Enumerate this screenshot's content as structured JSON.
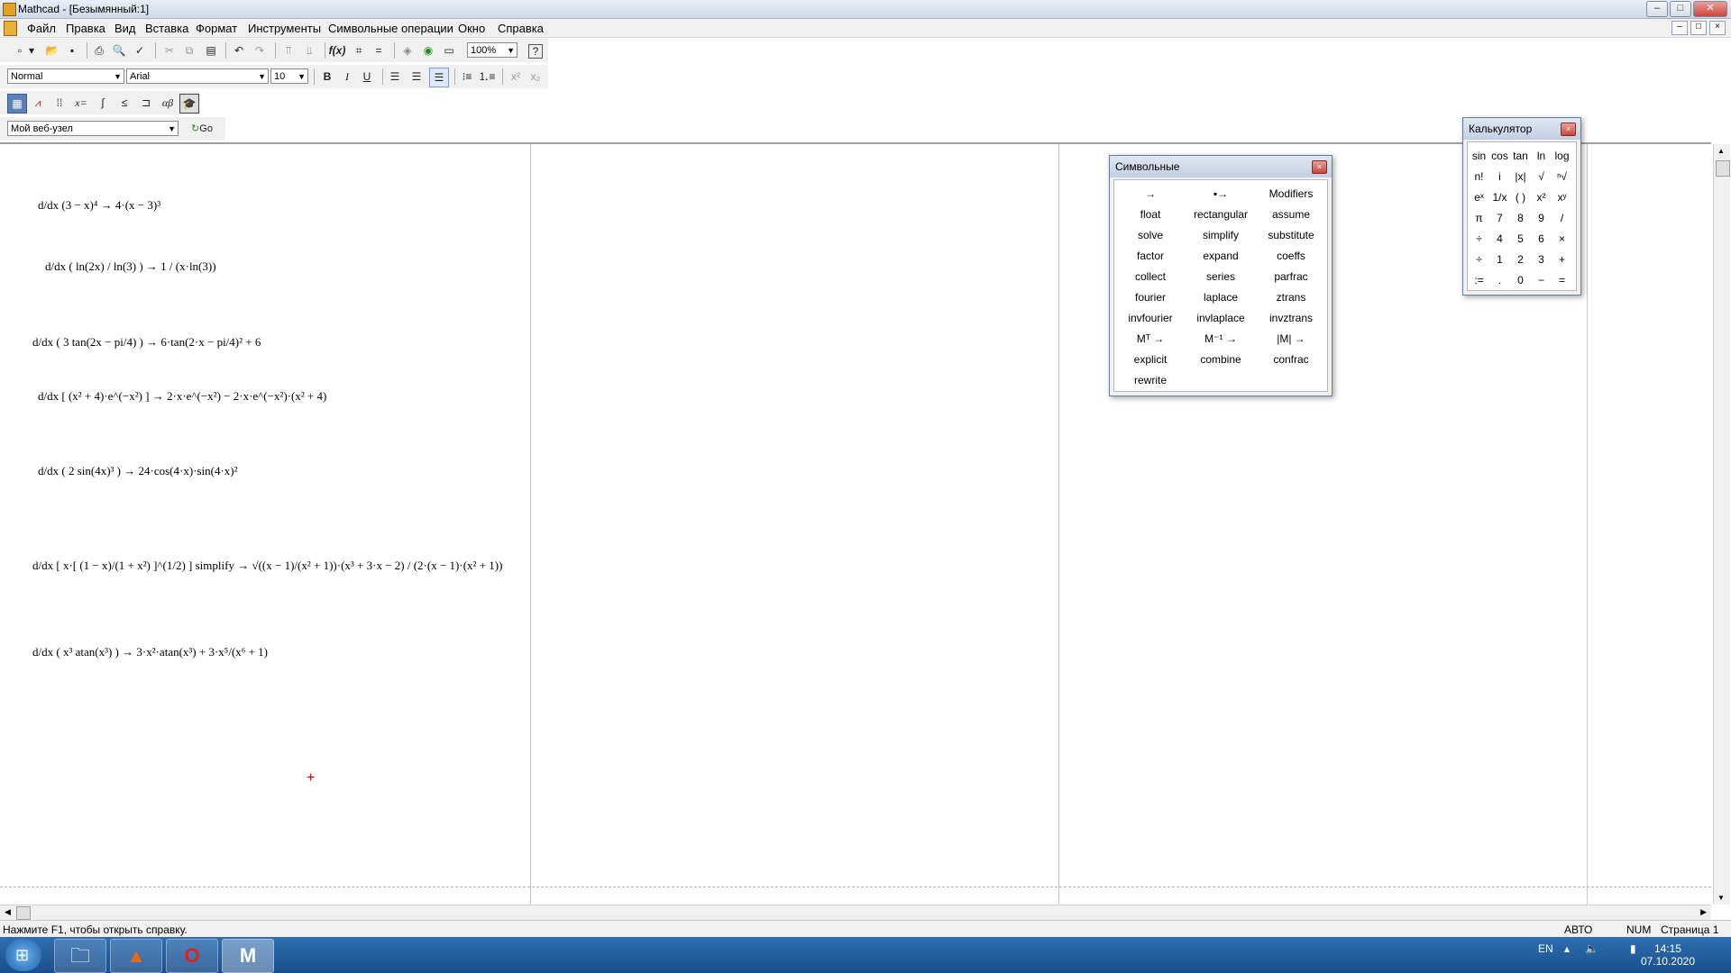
{
  "window": {
    "title": "Mathcad - [Безымянный:1]",
    "controls": [
      "–",
      "□",
      "✕"
    ]
  },
  "menu": {
    "items": [
      "Файл",
      "Правка",
      "Вид",
      "Вставка",
      "Формат",
      "Инструменты",
      "Символьные операции",
      "Окно",
      "Справка"
    ],
    "mdi_controls": [
      "–",
      "□",
      "×"
    ]
  },
  "toolbar_standard": {
    "zoom": "100%",
    "icons": [
      "new-icon",
      "open-icon",
      "save-icon",
      "print-icon",
      "print-preview-icon",
      "spell-check-icon",
      "cut-icon",
      "copy-icon",
      "paste-icon",
      "undo-icon",
      "redo-icon",
      "align-icon",
      "align-bottom-icon",
      "insert-function-icon",
      "insert-unit-icon",
      "calculate-icon",
      "component-icon",
      "resource-icon",
      "window-icon",
      "help-icon"
    ]
  },
  "toolbar_format": {
    "style": "Normal",
    "font": "Arial",
    "size": "10",
    "bold": "B",
    "italic": "I",
    "underline": "U"
  },
  "toolbar_math": {
    "icons": [
      "calculator-toolbar-icon",
      "graph-toolbar-icon",
      "matrix-toolbar-icon",
      "evaluation-toolbar-icon",
      "calculus-toolbar-icon",
      "boolean-toolbar-icon",
      "programming-toolbar-icon",
      "greek-toolbar-icon",
      "symbolic-toolbar-icon"
    ],
    "evaluation_label": "x=",
    "greek_label": "αβ"
  },
  "toolbar_web": {
    "url": "Мой веб-узел",
    "go_label": "Go"
  },
  "worksheet": {
    "expressions": [
      "d/dx (3 − x)⁴ → 4·(x − 3)³",
      "d/dx ( ln(2x) / ln(3) ) → 1 / (x·ln(3))",
      "d/dx ( 3 tan(2x − pi/4) ) → 6·tan(2·x − pi/4)² + 6",
      "d/dx [ (x² + 4)·e^(−x²) ] → 2·x·e^(−x²) − 2·x·e^(−x²)·(x² + 4)",
      "d/dx ( 2 sin(4x)³ ) → 24·cos(4·x)·sin(4·x)²",
      "d/dx [ x·[ (1 − x)/(1 + x²) ]^(1/2) ] simplify → √((x − 1)/(x² + 1))·(x³ + 3·x − 2) / (2·(x − 1)·(x² + 1))",
      "d/dx ( x³ atan(x³) ) → 3·x²·atan(x³) + 3·x⁵/(x⁶ + 1)"
    ],
    "cursor": "+"
  },
  "symbolic_palette": {
    "title": "Символьные",
    "close": "×",
    "rows": [
      [
        "→",
        "▪→",
        "Modifiers"
      ],
      [
        "float",
        "rectangular",
        "assume"
      ],
      [
        "solve",
        "simplify",
        "substitute"
      ],
      [
        "factor",
        "expand",
        "coeffs"
      ],
      [
        "collect",
        "series",
        "parfrac"
      ],
      [
        "fourier",
        "laplace",
        "ztrans"
      ],
      [
        "invfourier",
        "invlaplace",
        "invztrans"
      ],
      [
        "Mᵀ →",
        "M⁻¹ →",
        "|M| →"
      ],
      [
        "explicit",
        "combine",
        "confrac"
      ],
      [
        "rewrite",
        "",
        ""
      ]
    ]
  },
  "calculator_palette": {
    "title": "Калькулятор",
    "close": "×",
    "rows": [
      [
        "sin",
        "cos",
        "tan",
        "ln",
        "log"
      ],
      [
        "n!",
        "i",
        "|x|",
        "√",
        "ⁿ√"
      ],
      [
        "eˣ",
        "1/x",
        "( )",
        "x²",
        "xʸ"
      ],
      [
        "π",
        "7",
        "8",
        "9",
        "/"
      ],
      [
        "÷",
        "4",
        "5",
        "6",
        "×"
      ],
      [
        "÷",
        "1",
        "2",
        "3",
        "+"
      ],
      [
        ":=",
        ".",
        "0",
        "−",
        "="
      ]
    ]
  },
  "statusbar": {
    "help": "Нажмите F1, чтобы открыть справку.",
    "mode": "АВТО",
    "num": "NUM",
    "page": "Страница 1"
  },
  "taskbar": {
    "language": "EN",
    "time": "14:15",
    "date": "07.10.2020"
  }
}
